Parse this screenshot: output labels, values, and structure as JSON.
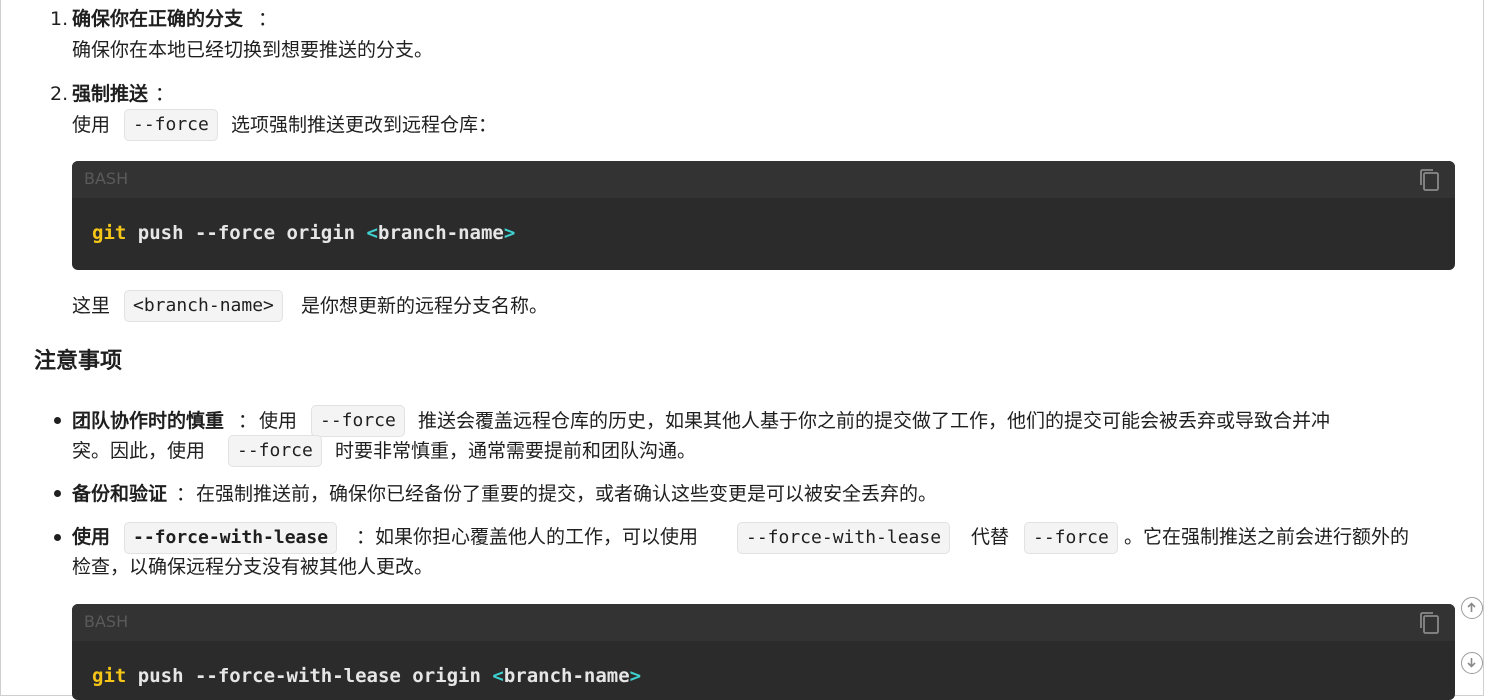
{
  "steps": [
    {
      "number": "1.",
      "title": "确保你在正确的分支",
      "colon": "：",
      "body": "确保你在本地已经切换到想要推送的分支。"
    },
    {
      "number": "2.",
      "title": "强制推送",
      "colon": "：",
      "body_before": "使用",
      "body_code": "--force",
      "body_after": "选项强制推送更改到远程仓库："
    }
  ],
  "codeblock1": {
    "lang": "BASH",
    "kw": "git",
    "cmd": " push --force origin ",
    "lt": "<",
    "arg": "branch-name",
    "gt": ">"
  },
  "note_line": {
    "before": "这里",
    "code": "<branch-name>",
    "after": "是你想更新的远程分支名称。"
  },
  "section_title": "注意事项",
  "bullets": {
    "b1": {
      "title": "团队协作时的慎重",
      "colon": "：",
      "t1": "使用",
      "c1": "--force",
      "t2": "推送会覆盖远程仓库的历史，如果其他人基于你之前的提交做了工作，他们的提交可能会被丢弃或导致合并冲",
      "t3": "突。因此，使用",
      "c2": "--force",
      "t4": "时要非常慎重，通常需要提前和团队沟通。"
    },
    "b2": {
      "title": "备份和验证",
      "colon": "：",
      "t1": "在强制推送前，确保你已经备份了重要的提交，或者确认这些变更是可以被安全丢弃的。"
    },
    "b3": {
      "title": "使用",
      "c1": "--force-with-lease",
      "t1": "：如果你担心覆盖他人的工作，可以使用",
      "c2": "--force-with-lease",
      "t2": "代替",
      "c3": "--force",
      "t3": "。它在强制推送之前会进行额外的",
      "t4": "检查，以确保远程分支没有被其他人更改。"
    }
  },
  "codeblock2": {
    "lang": "BASH",
    "kw": "git",
    "cmd": " push --force-with-lease origin ",
    "lt": "<",
    "arg": "branch-name",
    "gt": ">"
  },
  "icons": {
    "copy": "copy-icon",
    "scroll_up": "arrow-up-circle-icon",
    "scroll_down": "arrow-down-circle-icon"
  }
}
